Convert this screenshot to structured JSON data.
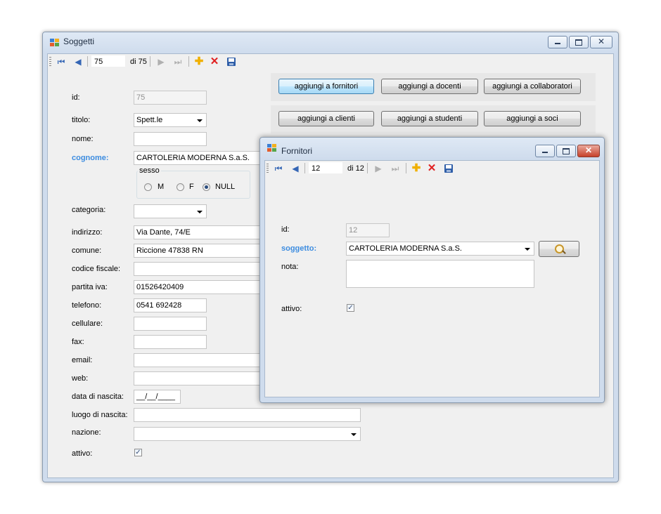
{
  "main_window": {
    "title": "Soggetti",
    "nav": {
      "position": "75",
      "count_text": "di 75"
    },
    "buttons": {
      "fornitori": "aggiungi a fornitori",
      "docenti": "aggiungi a docenti",
      "collaboratori": "aggiungi a collaboratori",
      "clienti": "aggiungi a clienti",
      "studenti": "aggiungi a studenti",
      "soci": "aggiungi a soci"
    },
    "labels": {
      "id": "id:",
      "titolo": "titolo:",
      "nome": "nome:",
      "cognome": "cognome:",
      "sesso": "sesso",
      "categoria": "categoria:",
      "indirizzo": "indirizzo:",
      "comune": "comune:",
      "codice_fiscale": "codice fiscale:",
      "partita_iva": "partita iva:",
      "telefono": "telefono:",
      "cellulare": "cellulare:",
      "fax": "fax:",
      "email": "email:",
      "web": "web:",
      "data_nascita": "data di nascita:",
      "luogo_nascita": "luogo di nascita:",
      "nazione": "nazione:",
      "attivo": "attivo:"
    },
    "values": {
      "id": "75",
      "titolo": "Spett.le",
      "nome": "",
      "cognome": "CARTOLERIA MODERNA S.a.S.",
      "categoria": "",
      "indirizzo": "Via Dante, 74/E",
      "comune": "Riccione 47838 RN",
      "codice_fiscale": "",
      "partita_iva": "01526420409",
      "telefono": "0541 692428",
      "cellulare": "",
      "fax": "",
      "email": "",
      "web": "",
      "data_nascita": "__/__/____",
      "luogo_nascita": "",
      "nazione": ""
    },
    "sesso_options": {
      "m": "M",
      "f": "F",
      "null": "NULL"
    },
    "sesso_selected": "NULL",
    "attivo_checked": true
  },
  "popup_window": {
    "title": "Fornitori",
    "nav": {
      "position": "12",
      "count_text": "di 12"
    },
    "labels": {
      "id": "id:",
      "soggetto": "soggetto:",
      "nota": "nota:",
      "attivo": "attivo:"
    },
    "values": {
      "id": "12",
      "soggetto": "CARTOLERIA MODERNA S.a.S.",
      "nota": ""
    },
    "attivo_checked": true
  },
  "icons": [
    "first-record-icon",
    "prev-record-icon",
    "next-record-icon",
    "last-record-icon",
    "add-icon",
    "delete-icon",
    "save-icon",
    "search-icon"
  ],
  "colors": {
    "required_label": "#3c8ce0",
    "delete": "#e02020",
    "add": "#f0b000"
  }
}
